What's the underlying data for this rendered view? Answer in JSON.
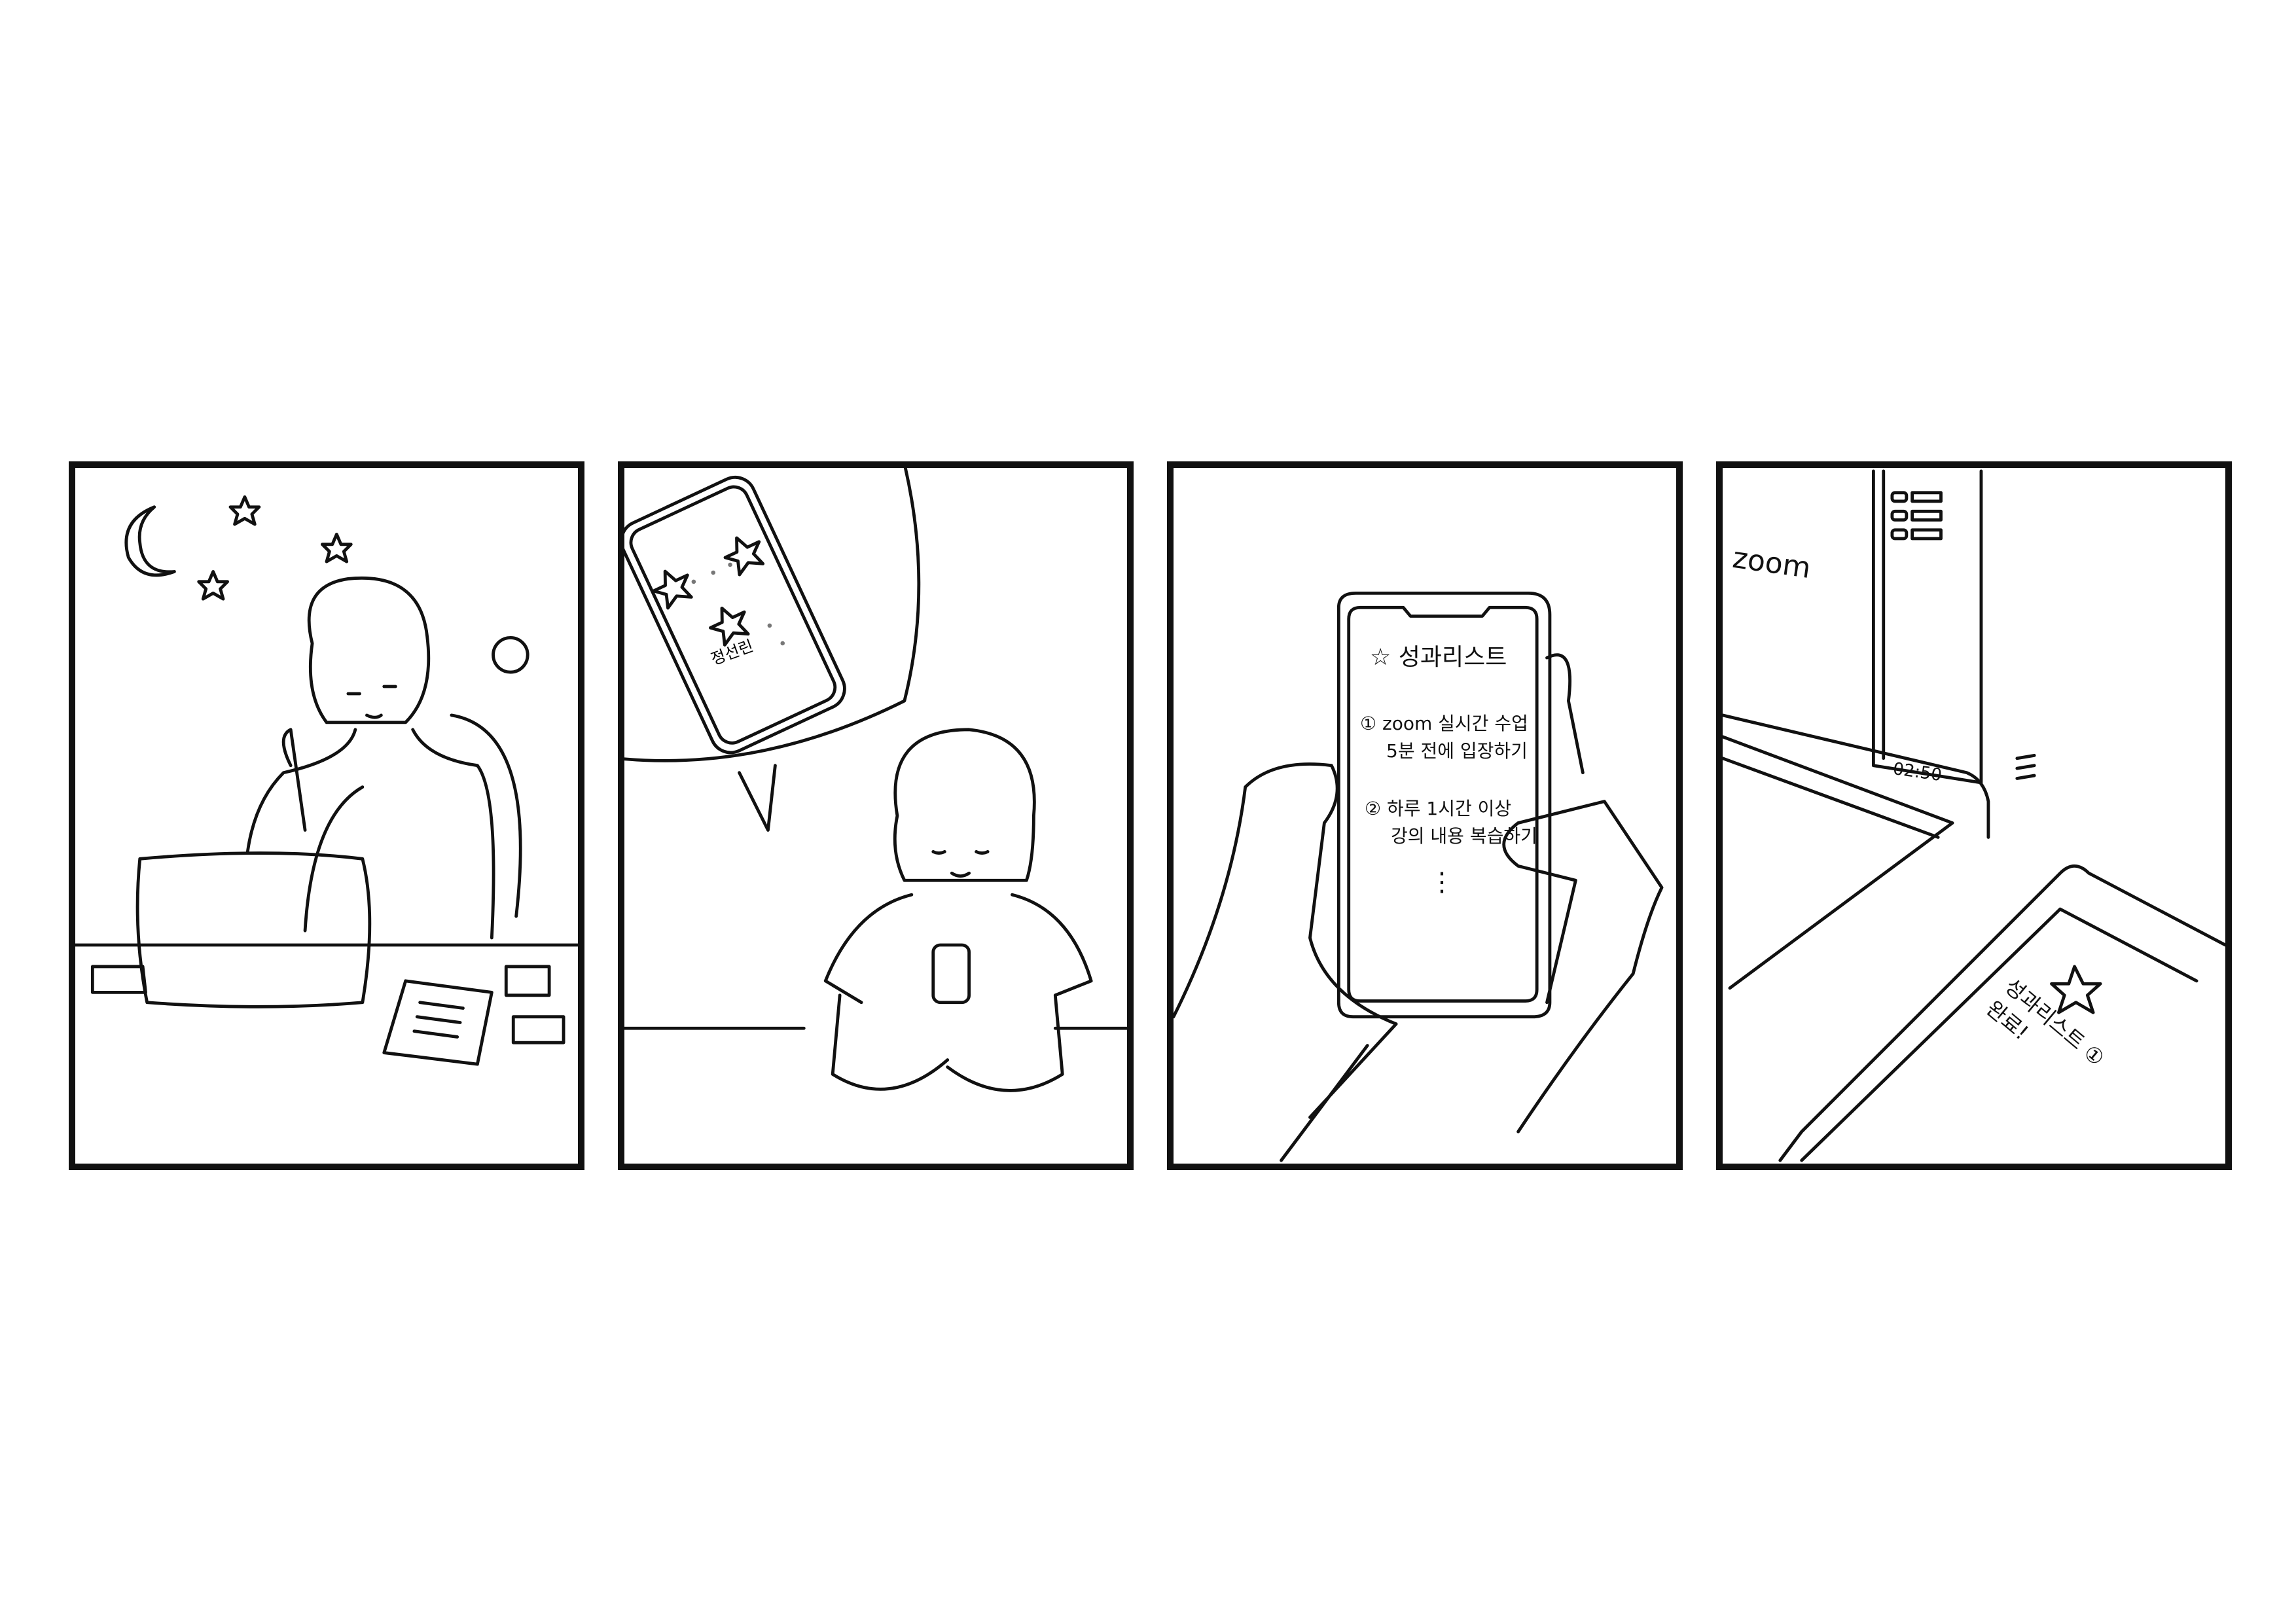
{
  "comic": {
    "panel1": {
      "scene": "late-night-study"
    },
    "panel2": {
      "phone_label": "정선린"
    },
    "panel3": {
      "list_title": "성과리스트",
      "items": [
        {
          "number": "①",
          "line1": "zoom 실시간 수업",
          "line2": "5분 전에 입장하기"
        },
        {
          "number": "②",
          "line1": "하루 1시간 이상",
          "line2": "강의 내용 복습하기"
        }
      ],
      "ellipsis": "⋮"
    },
    "panel4": {
      "app_name": "zoom",
      "timer": "02:50",
      "notification_line1": "성과리스트 ①",
      "notification_line2": "완료!"
    }
  },
  "colors": {
    "ink": "#111111",
    "background": "#ffffff"
  }
}
